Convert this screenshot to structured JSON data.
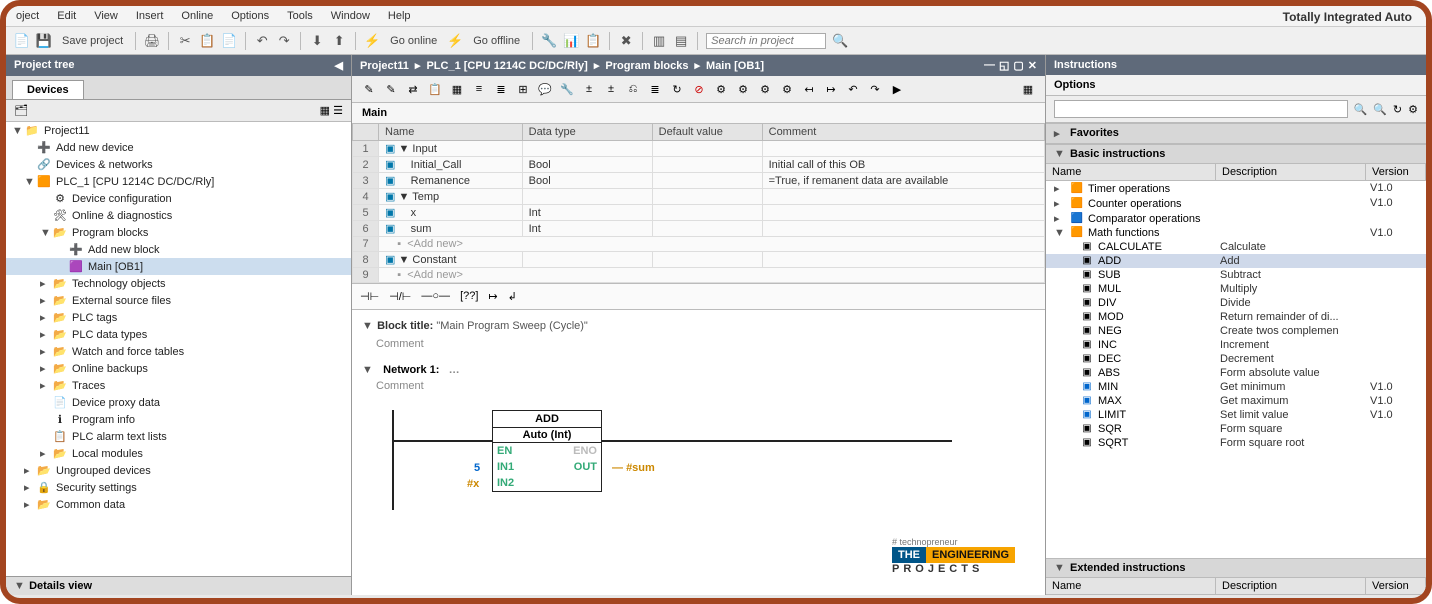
{
  "brand": "Totally Integrated Auto",
  "menu": [
    "oject",
    "Edit",
    "View",
    "Insert",
    "Online",
    "Options",
    "Tools",
    "Window",
    "Help"
  ],
  "toolbar": {
    "save": "Save project",
    "go_online": "Go online",
    "go_offline": "Go offline",
    "search_ph": "Search in project"
  },
  "left": {
    "title": "Project tree",
    "tab": "Devices",
    "details": "Details view",
    "items": [
      {
        "lvl": 0,
        "exp": "▼",
        "ico": "📁",
        "txt": "Project11"
      },
      {
        "lvl": 1,
        "exp": "",
        "ico": "➕",
        "txt": "Add new device"
      },
      {
        "lvl": 1,
        "exp": "",
        "ico": "🔗",
        "txt": "Devices & networks"
      },
      {
        "lvl": 1,
        "exp": "▼",
        "ico": "🟧",
        "txt": "PLC_1 [CPU 1214C DC/DC/Rly]"
      },
      {
        "lvl": 2,
        "exp": "",
        "ico": "⚙",
        "txt": "Device configuration"
      },
      {
        "lvl": 2,
        "exp": "",
        "ico": "🛠",
        "txt": "Online & diagnostics"
      },
      {
        "lvl": 2,
        "exp": "▼",
        "ico": "📂",
        "txt": "Program blocks"
      },
      {
        "lvl": 3,
        "exp": "",
        "ico": "➕",
        "txt": "Add new block"
      },
      {
        "lvl": 3,
        "exp": "",
        "ico": "🟪",
        "txt": "Main [OB1]",
        "sel": true
      },
      {
        "lvl": 2,
        "exp": "▸",
        "ico": "📂",
        "txt": "Technology objects"
      },
      {
        "lvl": 2,
        "exp": "▸",
        "ico": "📂",
        "txt": "External source files"
      },
      {
        "lvl": 2,
        "exp": "▸",
        "ico": "📂",
        "txt": "PLC tags"
      },
      {
        "lvl": 2,
        "exp": "▸",
        "ico": "📂",
        "txt": "PLC data types"
      },
      {
        "lvl": 2,
        "exp": "▸",
        "ico": "📂",
        "txt": "Watch and force tables"
      },
      {
        "lvl": 2,
        "exp": "▸",
        "ico": "📂",
        "txt": "Online backups"
      },
      {
        "lvl": 2,
        "exp": "▸",
        "ico": "📂",
        "txt": "Traces"
      },
      {
        "lvl": 2,
        "exp": "",
        "ico": "📄",
        "txt": "Device proxy data"
      },
      {
        "lvl": 2,
        "exp": "",
        "ico": "ℹ",
        "txt": "Program info"
      },
      {
        "lvl": 2,
        "exp": "",
        "ico": "📋",
        "txt": "PLC alarm text lists"
      },
      {
        "lvl": 2,
        "exp": "▸",
        "ico": "📂",
        "txt": "Local modules"
      },
      {
        "lvl": 1,
        "exp": "▸",
        "ico": "📂",
        "txt": "Ungrouped devices"
      },
      {
        "lvl": 1,
        "exp": "▸",
        "ico": "🔒",
        "txt": "Security settings"
      },
      {
        "lvl": 1,
        "exp": "▸",
        "ico": "📂",
        "txt": "Common data"
      }
    ]
  },
  "mid": {
    "crumbs": [
      "Project11",
      "PLC_1 [CPU 1214C DC/DC/Rly]",
      "Program blocks",
      "Main [OB1]"
    ],
    "main_label": "Main",
    "cols": [
      "",
      "Name",
      "Data type",
      "Default value",
      "Comment"
    ],
    "rows": [
      {
        "n": "1",
        "exp": "▼",
        "name": "Input",
        "dt": "",
        "dv": "",
        "cm": ""
      },
      {
        "n": "2",
        "exp": "",
        "name": "Initial_Call",
        "dt": "Bool",
        "dv": "",
        "cm": "Initial call of this OB"
      },
      {
        "n": "3",
        "exp": "",
        "name": "Remanence",
        "dt": "Bool",
        "dv": "",
        "cm": "=True, if remanent data are available"
      },
      {
        "n": "4",
        "exp": "▼",
        "name": "Temp",
        "dt": "",
        "dv": "",
        "cm": ""
      },
      {
        "n": "5",
        "exp": "",
        "name": "x",
        "dt": "Int",
        "dv": "",
        "cm": ""
      },
      {
        "n": "6",
        "exp": "",
        "name": "sum",
        "dt": "Int",
        "dv": "",
        "cm": ""
      },
      {
        "n": "7",
        "exp": "",
        "name": "<Add new>",
        "add": true
      },
      {
        "n": "8",
        "exp": "▼",
        "name": "Constant",
        "dt": "",
        "dv": "",
        "cm": ""
      },
      {
        "n": "9",
        "exp": "",
        "name": "<Add new>",
        "add": true
      }
    ],
    "block_title_lbl": "Block title:",
    "block_title_val": "\"Main Program Sweep (Cycle)\"",
    "comment_lbl": "Comment",
    "network_lbl": "Network 1:",
    "add_box": {
      "title": "ADD",
      "sub": "Auto (Int)",
      "en": "EN",
      "eno": "ENO",
      "in1": "IN1",
      "in2": "IN2",
      "out": "OUT"
    },
    "sig_in1": "5",
    "sig_in2": "#x",
    "sig_out": "#sum",
    "logo": {
      "tag": "# technopreneur",
      "l1": "THE",
      "l2": "ENGINEERING",
      "l3": "PROJECTS"
    }
  },
  "right": {
    "title": "Instructions",
    "options": "Options",
    "fav": "Favorites",
    "basic": "Basic instructions",
    "ext": "Extended instructions",
    "head": {
      "name": "Name",
      "desc": "Description",
      "ver": "Version"
    },
    "groups": [
      {
        "exp": "▸",
        "ico": "🟧",
        "name": "Timer operations",
        "desc": "",
        "ver": "V1.0"
      },
      {
        "exp": "▸",
        "ico": "🟧",
        "name": "Counter operations",
        "desc": "",
        "ver": "V1.0"
      },
      {
        "exp": "▸",
        "ico": "🟦",
        "name": "Comparator operations",
        "desc": "",
        "ver": ""
      },
      {
        "exp": "▼",
        "ico": "🟧",
        "name": "Math functions",
        "desc": "",
        "ver": "V1.0"
      }
    ],
    "math": [
      {
        "name": "CALCULATE",
        "desc": "Calculate",
        "ver": ""
      },
      {
        "name": "ADD",
        "desc": "Add",
        "ver": "",
        "sel": true
      },
      {
        "name": "SUB",
        "desc": "Subtract",
        "ver": ""
      },
      {
        "name": "MUL",
        "desc": "Multiply",
        "ver": ""
      },
      {
        "name": "DIV",
        "desc": "Divide",
        "ver": ""
      },
      {
        "name": "MOD",
        "desc": "Return remainder of di...",
        "ver": ""
      },
      {
        "name": "NEG",
        "desc": "Create twos complemen",
        "ver": ""
      },
      {
        "name": "INC",
        "desc": "Increment",
        "ver": ""
      },
      {
        "name": "DEC",
        "desc": "Decrement",
        "ver": ""
      },
      {
        "name": "ABS",
        "desc": "Form absolute value",
        "ver": ""
      },
      {
        "name": "MIN",
        "desc": "Get minimum",
        "ver": "V1.0",
        "blue": true
      },
      {
        "name": "MAX",
        "desc": "Get maximum",
        "ver": "V1.0",
        "blue": true
      },
      {
        "name": "LIMIT",
        "desc": "Set limit value",
        "ver": "V1.0",
        "blue": true
      },
      {
        "name": "SQR",
        "desc": "Form square",
        "ver": ""
      },
      {
        "name": "SQRT",
        "desc": "Form square root",
        "ver": ""
      }
    ]
  }
}
